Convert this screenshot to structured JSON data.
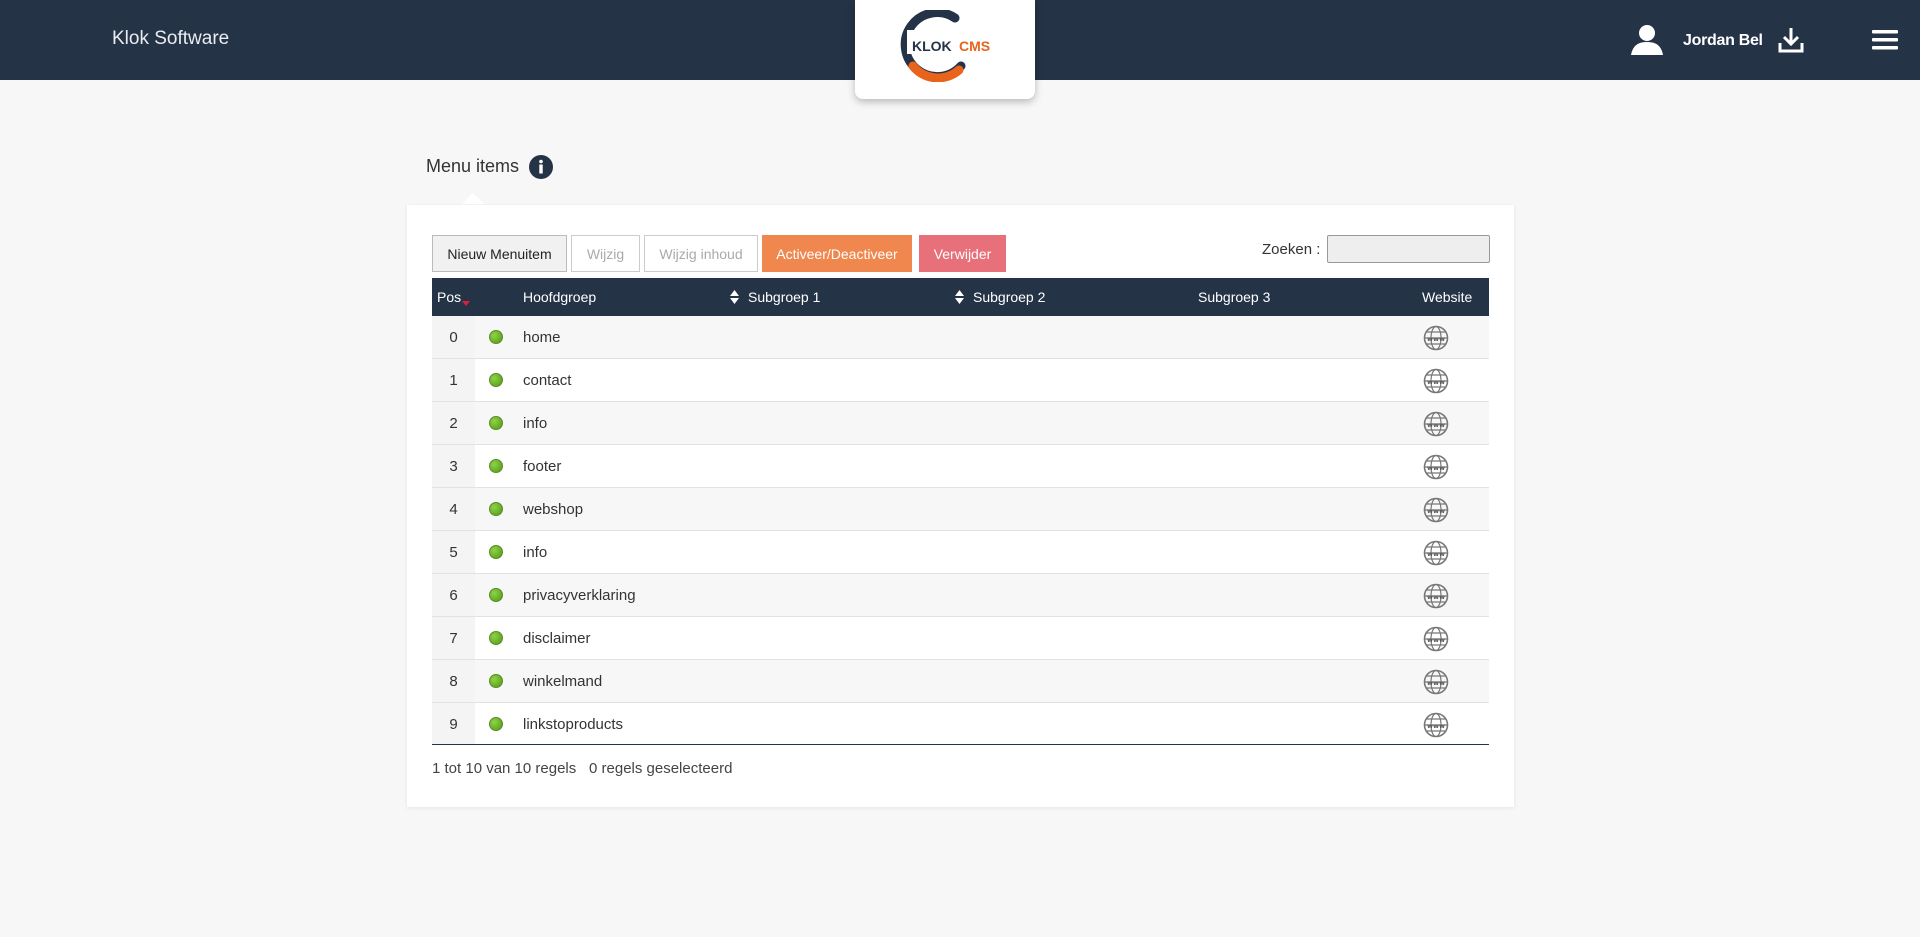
{
  "header": {
    "brand": "Klok Software",
    "logo": {
      "word1": "KLOK",
      "word2": "CMS"
    },
    "user_name": "Jordan Bel",
    "icons": {
      "user": "user-icon",
      "download": "download-icon",
      "menu": "hamburger-menu-icon"
    }
  },
  "page": {
    "title": "Menu items",
    "info_icon": "info-icon"
  },
  "toolbar": {
    "new_label": "Nieuw Menuitem",
    "edit_label": "Wijzig",
    "edit_content_label": "Wijzig inhoud",
    "activate_label": "Activeer/Deactiveer",
    "delete_label": "Verwijder",
    "search_label": "Zoeken :",
    "search_value": ""
  },
  "table": {
    "columns": {
      "pos": "Pos",
      "main_group": "Hoofdgroep",
      "subgroup1": "Subgroep 1",
      "subgroup2": "Subgroep 2",
      "subgroup3": "Subgroep 3",
      "website": "Website"
    },
    "rows": [
      {
        "pos": "0",
        "name": "home",
        "status": "active"
      },
      {
        "pos": "1",
        "name": "contact",
        "status": "active"
      },
      {
        "pos": "2",
        "name": "info",
        "status": "active"
      },
      {
        "pos": "3",
        "name": "footer",
        "status": "active"
      },
      {
        "pos": "4",
        "name": "webshop",
        "status": "active"
      },
      {
        "pos": "5",
        "name": "info",
        "status": "active"
      },
      {
        "pos": "6",
        "name": "privacyverklaring",
        "status": "active"
      },
      {
        "pos": "7",
        "name": "disclaimer",
        "status": "active"
      },
      {
        "pos": "8",
        "name": "winkelmand",
        "status": "active"
      },
      {
        "pos": "9",
        "name": "linkstoproducts",
        "status": "active"
      }
    ]
  },
  "footer": {
    "range_text": "1 tot 10 van 10 regels",
    "selected_text": "0 regels geselecteerd"
  },
  "colors": {
    "header_bg": "#253347",
    "accent_orange": "#f0874f",
    "danger_red": "#e8707a",
    "status_green": "#6ab42a"
  }
}
